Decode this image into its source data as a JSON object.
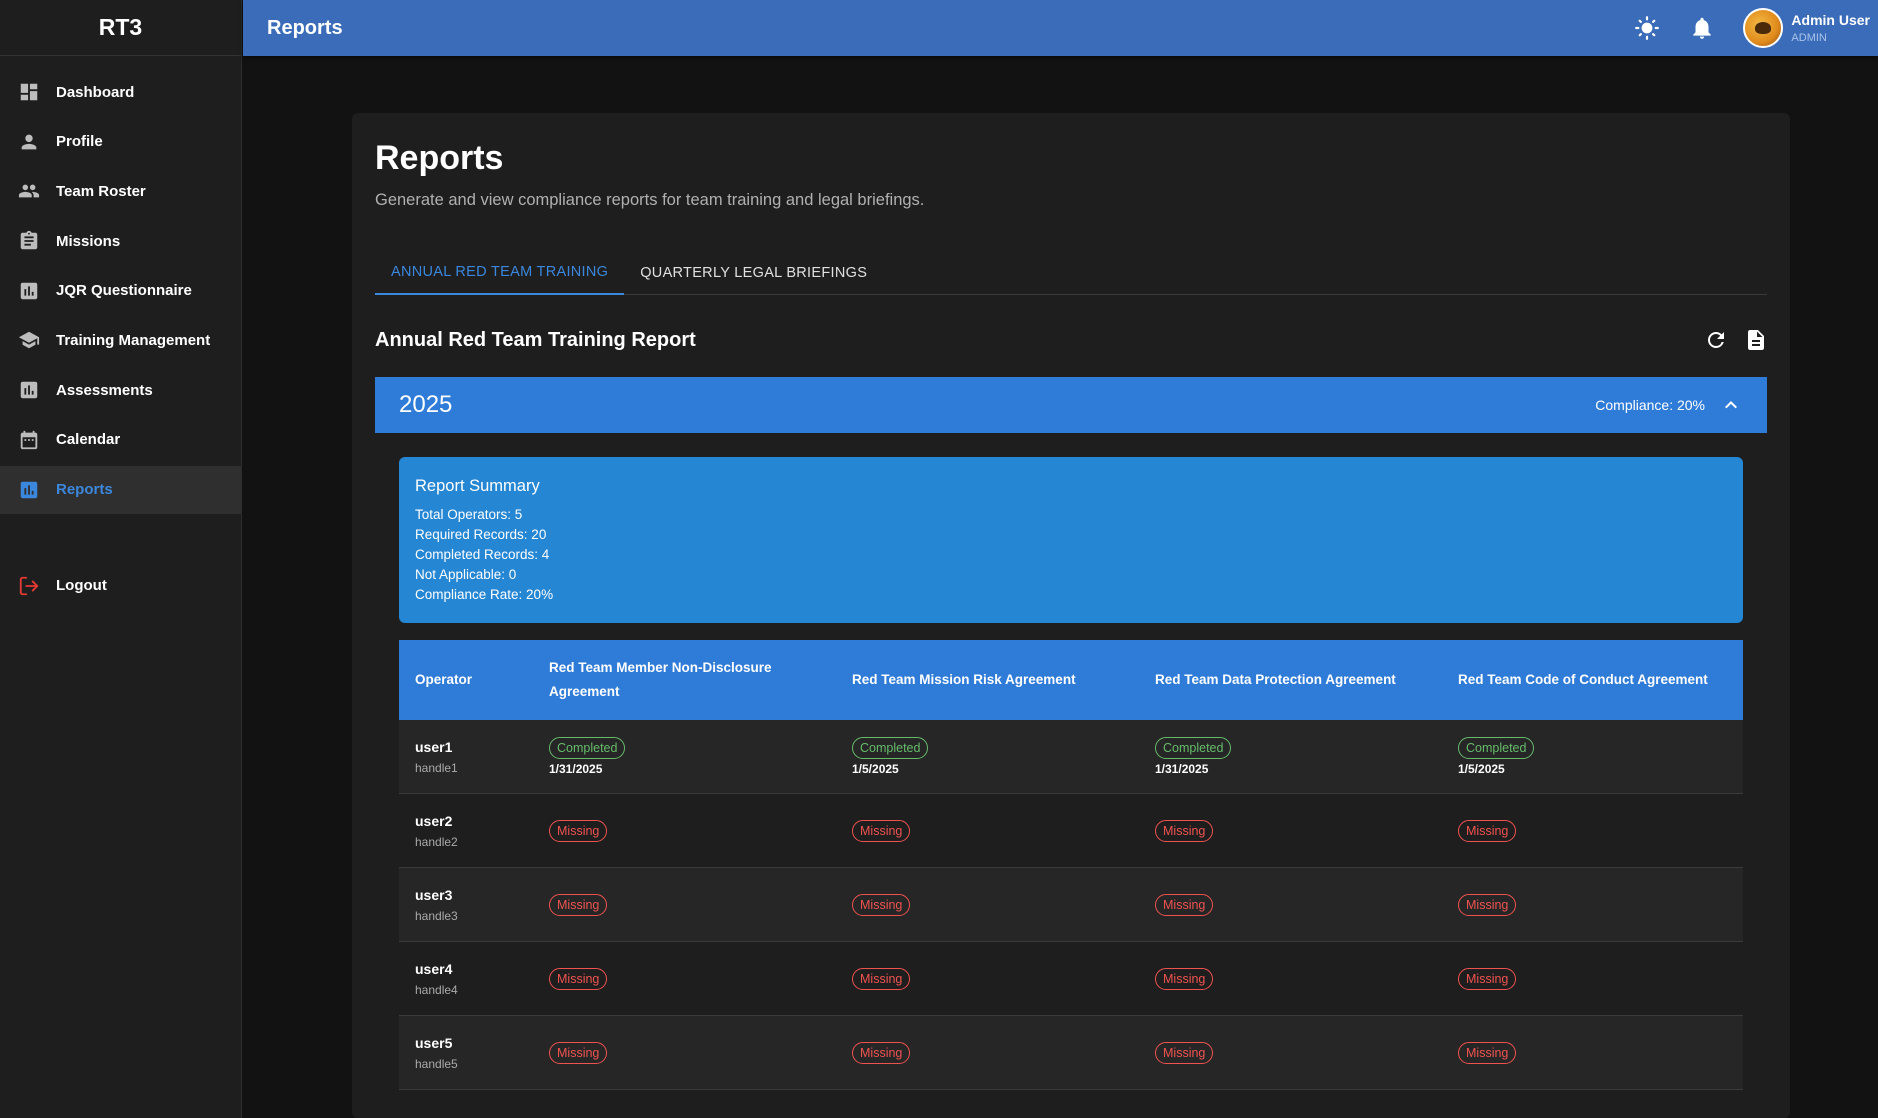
{
  "app": {
    "brand": "RT3"
  },
  "sidebar": {
    "items": [
      {
        "label": "Dashboard",
        "icon": "dashboard-icon"
      },
      {
        "label": "Profile",
        "icon": "person-icon"
      },
      {
        "label": "Team Roster",
        "icon": "group-icon"
      },
      {
        "label": "Missions",
        "icon": "clipboard-icon"
      },
      {
        "label": "JQR Questionnaire",
        "icon": "bar-chart-icon"
      },
      {
        "label": "Training Management",
        "icon": "school-icon"
      },
      {
        "label": "Assessments",
        "icon": "bar-chart-icon"
      },
      {
        "label": "Calendar",
        "icon": "calendar-icon"
      },
      {
        "label": "Reports",
        "icon": "bar-chart-icon",
        "active": true
      }
    ],
    "logout": "Logout"
  },
  "topbar": {
    "title": "Reports",
    "user_name": "Admin User",
    "user_role": "ADMIN",
    "icons": [
      "brightness-icon",
      "bell-icon"
    ]
  },
  "page": {
    "title": "Reports",
    "subtitle": "Generate and view compliance reports for team training and legal briefings.",
    "tabs": [
      {
        "label": "ANNUAL RED TEAM TRAINING",
        "active": true
      },
      {
        "label": "QUARTERLY LEGAL BRIEFINGS",
        "active": false
      }
    ],
    "section_title": "Annual Red Team Training Report",
    "year": "2025",
    "compliance": "Compliance: 20%"
  },
  "summary": {
    "title": "Report Summary",
    "lines": [
      "Total Operators: 5",
      "Required Records: 20",
      "Completed Records: 4",
      "Not Applicable: 0",
      "Compliance Rate: 20%"
    ]
  },
  "table": {
    "headers": [
      "Operator",
      "Red Team Member Non-Disclosure Agreement",
      "Red Team Mission Risk Agreement",
      "Red Team Data Protection Agreement",
      "Red Team Code of Conduct Agreement"
    ],
    "rows": [
      {
        "name": "user1",
        "handle": "handle1",
        "cells": [
          {
            "status": "Completed",
            "date": "1/31/2025"
          },
          {
            "status": "Completed",
            "date": "1/5/2025"
          },
          {
            "status": "Completed",
            "date": "1/31/2025"
          },
          {
            "status": "Completed",
            "date": "1/5/2025"
          }
        ]
      },
      {
        "name": "user2",
        "handle": "handle2",
        "cells": [
          {
            "status": "Missing"
          },
          {
            "status": "Missing"
          },
          {
            "status": "Missing"
          },
          {
            "status": "Missing"
          }
        ]
      },
      {
        "name": "user3",
        "handle": "handle3",
        "cells": [
          {
            "status": "Missing"
          },
          {
            "status": "Missing"
          },
          {
            "status": "Missing"
          },
          {
            "status": "Missing"
          }
        ]
      },
      {
        "name": "user4",
        "handle": "handle4",
        "cells": [
          {
            "status": "Missing"
          },
          {
            "status": "Missing"
          },
          {
            "status": "Missing"
          },
          {
            "status": "Missing"
          }
        ]
      },
      {
        "name": "user5",
        "handle": "handle5",
        "cells": [
          {
            "status": "Missing"
          },
          {
            "status": "Missing"
          },
          {
            "status": "Missing"
          },
          {
            "status": "Missing"
          }
        ]
      }
    ]
  },
  "colors": {
    "accent": "#2f7bd8",
    "completed": "#66bb6a",
    "missing": "#ef5350"
  }
}
